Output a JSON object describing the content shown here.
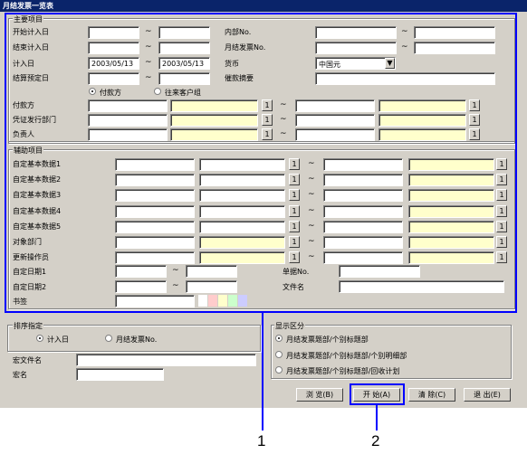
{
  "window": {
    "title": "月结发票一览表"
  },
  "main_group": {
    "title": "主要项目",
    "labels": {
      "start_date": "开始计入日",
      "end_date": "结束计入日",
      "entry_date": "计入日",
      "settle_date": "结算预定日",
      "internal_no": "内部No.",
      "invoice_no": "月结发票No.",
      "currency": "货币",
      "reminder": "催款摘要",
      "payer": "付款方",
      "dept": "凭证发行部门",
      "person": "负责人"
    },
    "values": {
      "entry_date_from": "2003/05/13",
      "entry_date_to": "2003/05/13",
      "currency": "中国元"
    },
    "radios": [
      {
        "label": "付款方"
      },
      {
        "label": "往来客户组"
      }
    ]
  },
  "aux_group": {
    "title": "辅助项目",
    "rows": [
      "自定基本数据1",
      "自定基本数据2",
      "自定基本数据3",
      "自定基本数据4",
      "自定基本数据5",
      "对象部门",
      "更新操作员"
    ],
    "labels": {
      "custom_date1": "自定日期1",
      "custom_date2": "自定日期2",
      "document_no": "单据No.",
      "filename": "文件名",
      "bookmark": "书签"
    }
  },
  "sort_group": {
    "title": "排序指定",
    "radios": [
      {
        "label": "计入日"
      },
      {
        "label": "月结发票No."
      }
    ]
  },
  "macro": {
    "file_label": "宏文件名",
    "name_label": "宏名"
  },
  "display_group": {
    "title": "显示区分",
    "options": [
      "月结发票题部/个别标题部",
      "月结发票题部/个别标题部/个别明细部",
      "月结发票题部/个别标题部/回收计划"
    ]
  },
  "buttons": {
    "browse": "浏  览(B)",
    "start": "开  始(A)",
    "clear": "清  除(C)",
    "exit": "退  出(E)"
  },
  "small_btn": "1",
  "tilde": "~",
  "callouts": [
    "1",
    "2"
  ],
  "colors": {
    "highlight": "#0000ff",
    "field_yellow": "#ffffcc",
    "title_bar": "#0a246a"
  },
  "swatches": [
    "#ffffff",
    "#ffcccc",
    "#ffffcc",
    "#ccffcc",
    "#ccccff"
  ]
}
